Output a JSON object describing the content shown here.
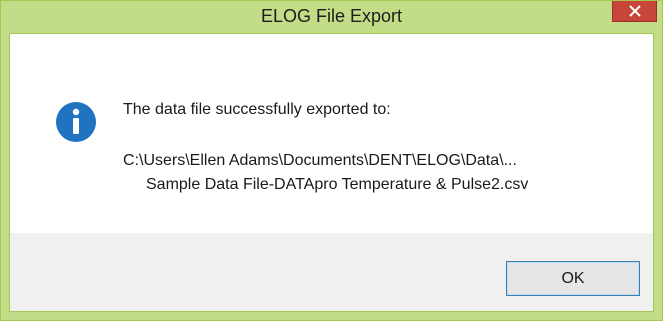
{
  "window": {
    "title": "ELOG File Export",
    "close_icon": "close-icon"
  },
  "message": {
    "icon": "info-icon",
    "text": "The data file successfully exported to:",
    "path_line1": "C:\\Users\\Ellen Adams\\Documents\\DENT\\ELOG\\Data\\...",
    "path_line2": "Sample Data File-DATApro Temperature & Pulse2.csv"
  },
  "buttons": {
    "ok_label": "OK"
  },
  "colors": {
    "titlebar": "#c2dc88",
    "close_button": "#c7463a",
    "info_icon": "#1f73c0",
    "button_border": "#3c7fb1"
  }
}
